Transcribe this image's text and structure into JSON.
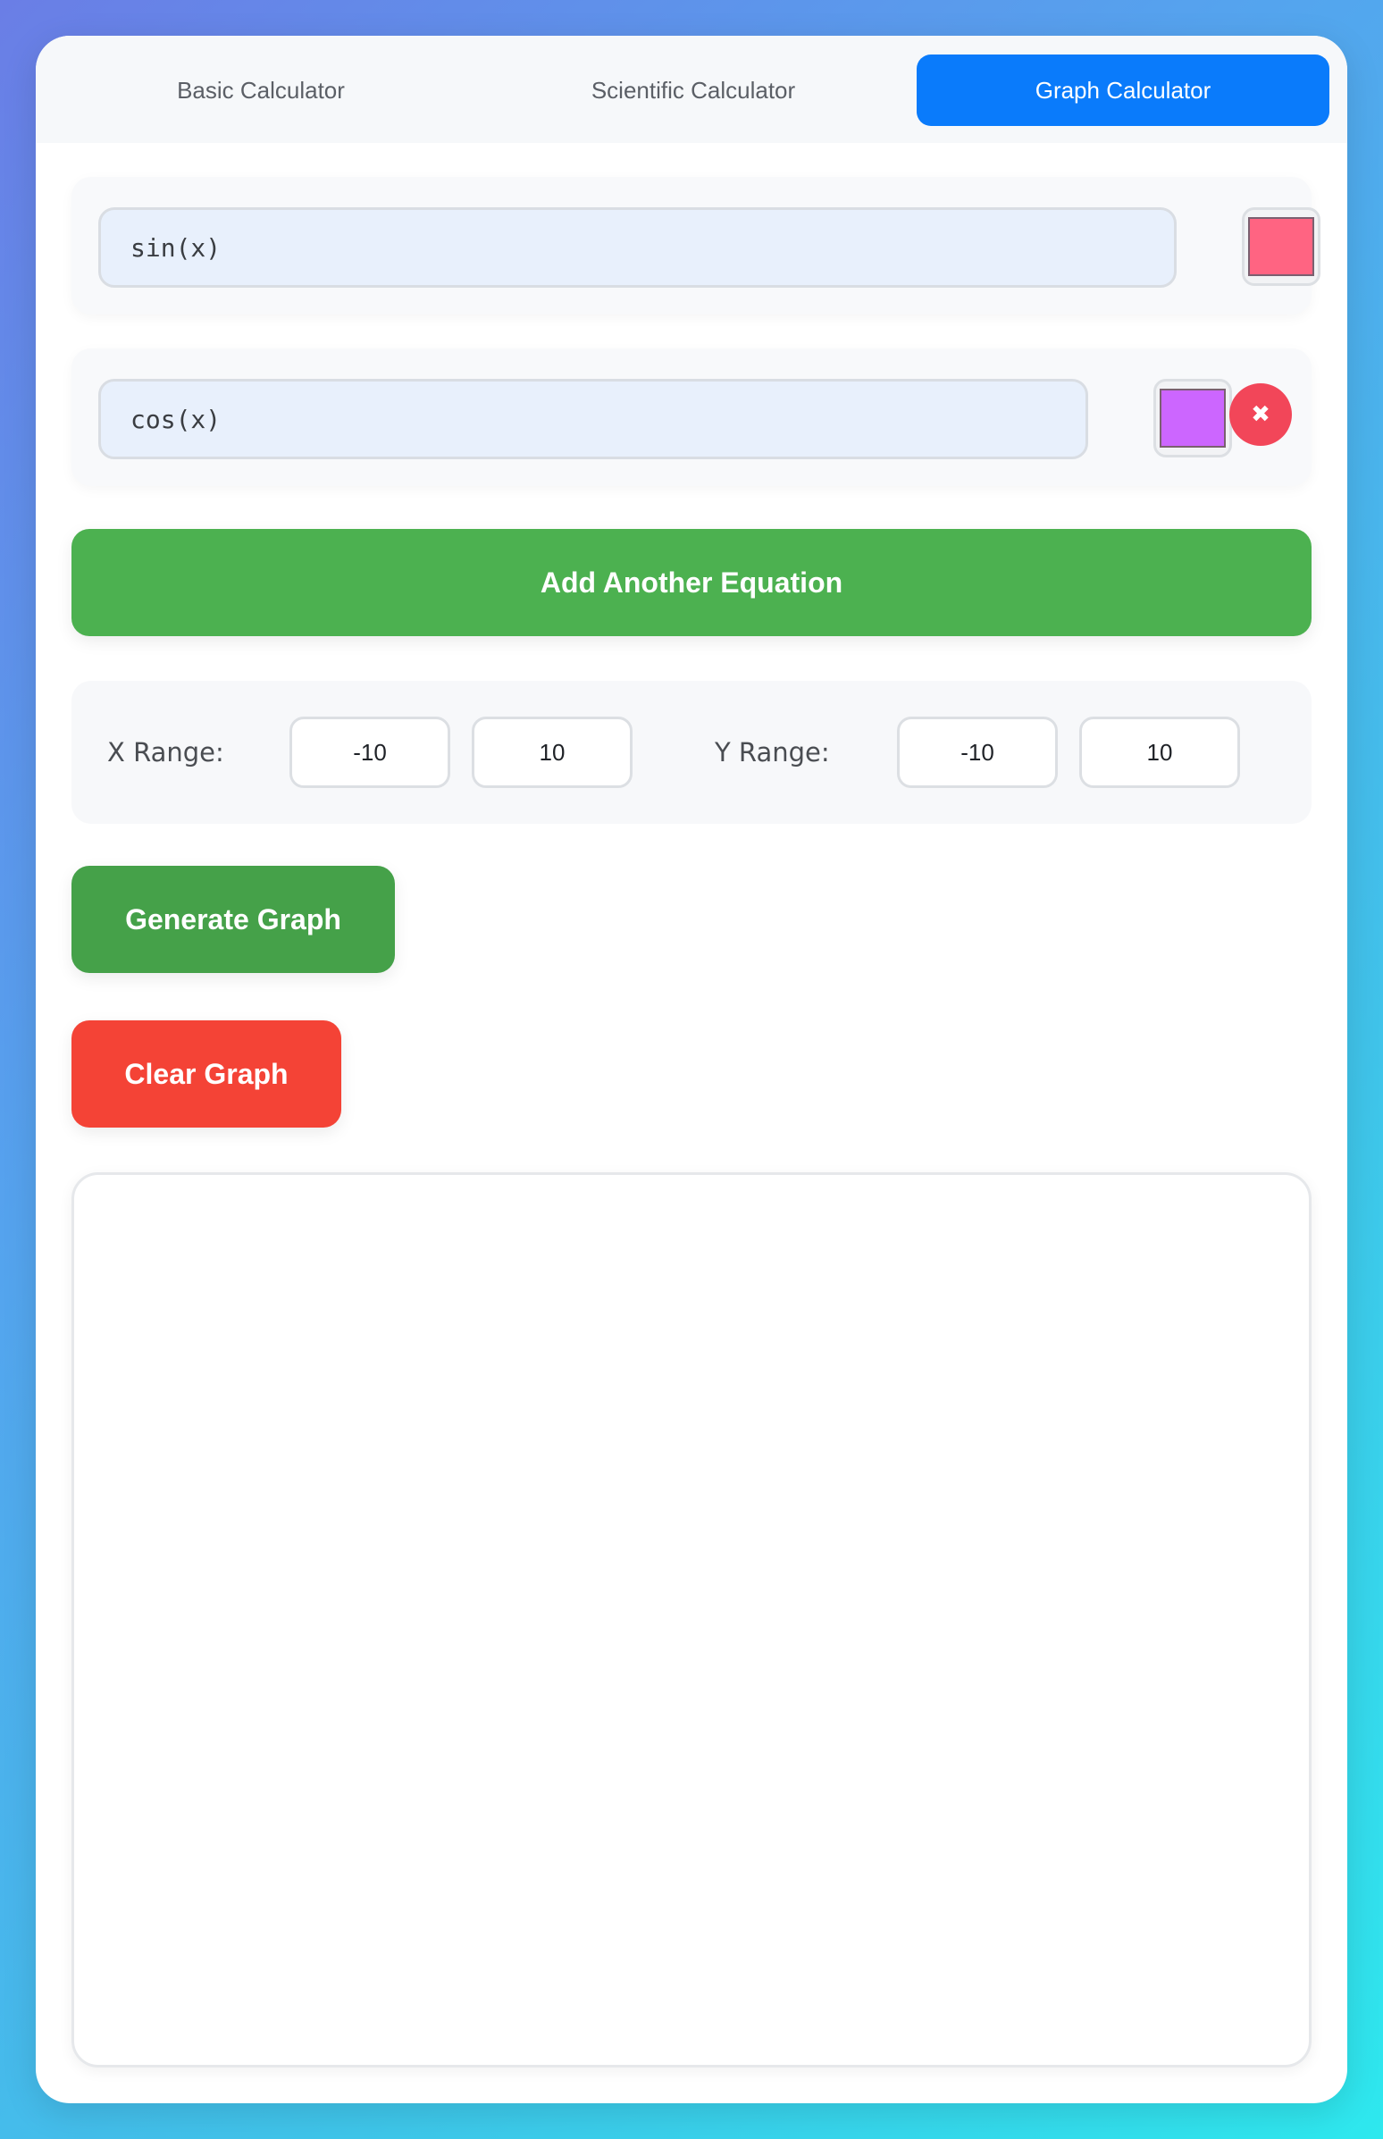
{
  "tabs": [
    {
      "label": "Basic Calculator",
      "active": false
    },
    {
      "label": "Scientific Calculator",
      "active": false
    },
    {
      "label": "Graph Calculator",
      "active": true
    }
  ],
  "equations": [
    {
      "expression": "sin(x)",
      "color": "#ff6482",
      "removable": false
    },
    {
      "expression": "cos(x)",
      "color": "#cc66ff",
      "removable": true
    }
  ],
  "remove_icon": "✖",
  "add_button_label": "Add Another Equation",
  "ranges": {
    "x_label": "X Range:",
    "x_min": "-10",
    "x_max": "10",
    "y_label": "Y Range:",
    "y_min": "-10",
    "y_max": "10"
  },
  "generate_button_label": "Generate Graph",
  "clear_button_label": "Clear Graph",
  "colors": {
    "active_tab": "#0a7bfb",
    "add_button": "#4cb150",
    "generate_button": "#45a149",
    "clear_button": "#f44336",
    "remove_button": "#f24659"
  }
}
